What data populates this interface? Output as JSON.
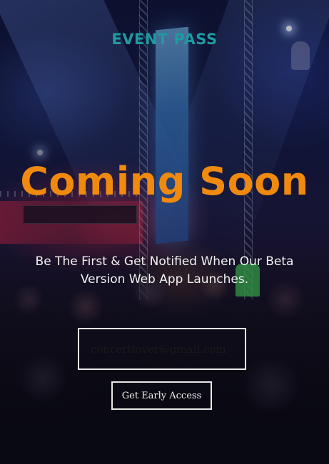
{
  "header": {
    "brand": "EVENT PASS"
  },
  "hero": {
    "headline": "Coming Soon",
    "tagline": "Be The First & Get Notified When Our Beta Version Web App Launches."
  },
  "signup": {
    "email_placeholder": "concertlover@gmail.com",
    "cta_label": "Get Early Access"
  },
  "theme": {
    "brand_color": "#1f9aa0",
    "headline_color": "#f08a0f",
    "text_color": "#f2f2f2"
  },
  "background": {
    "image": "concert-crowd-photo"
  }
}
